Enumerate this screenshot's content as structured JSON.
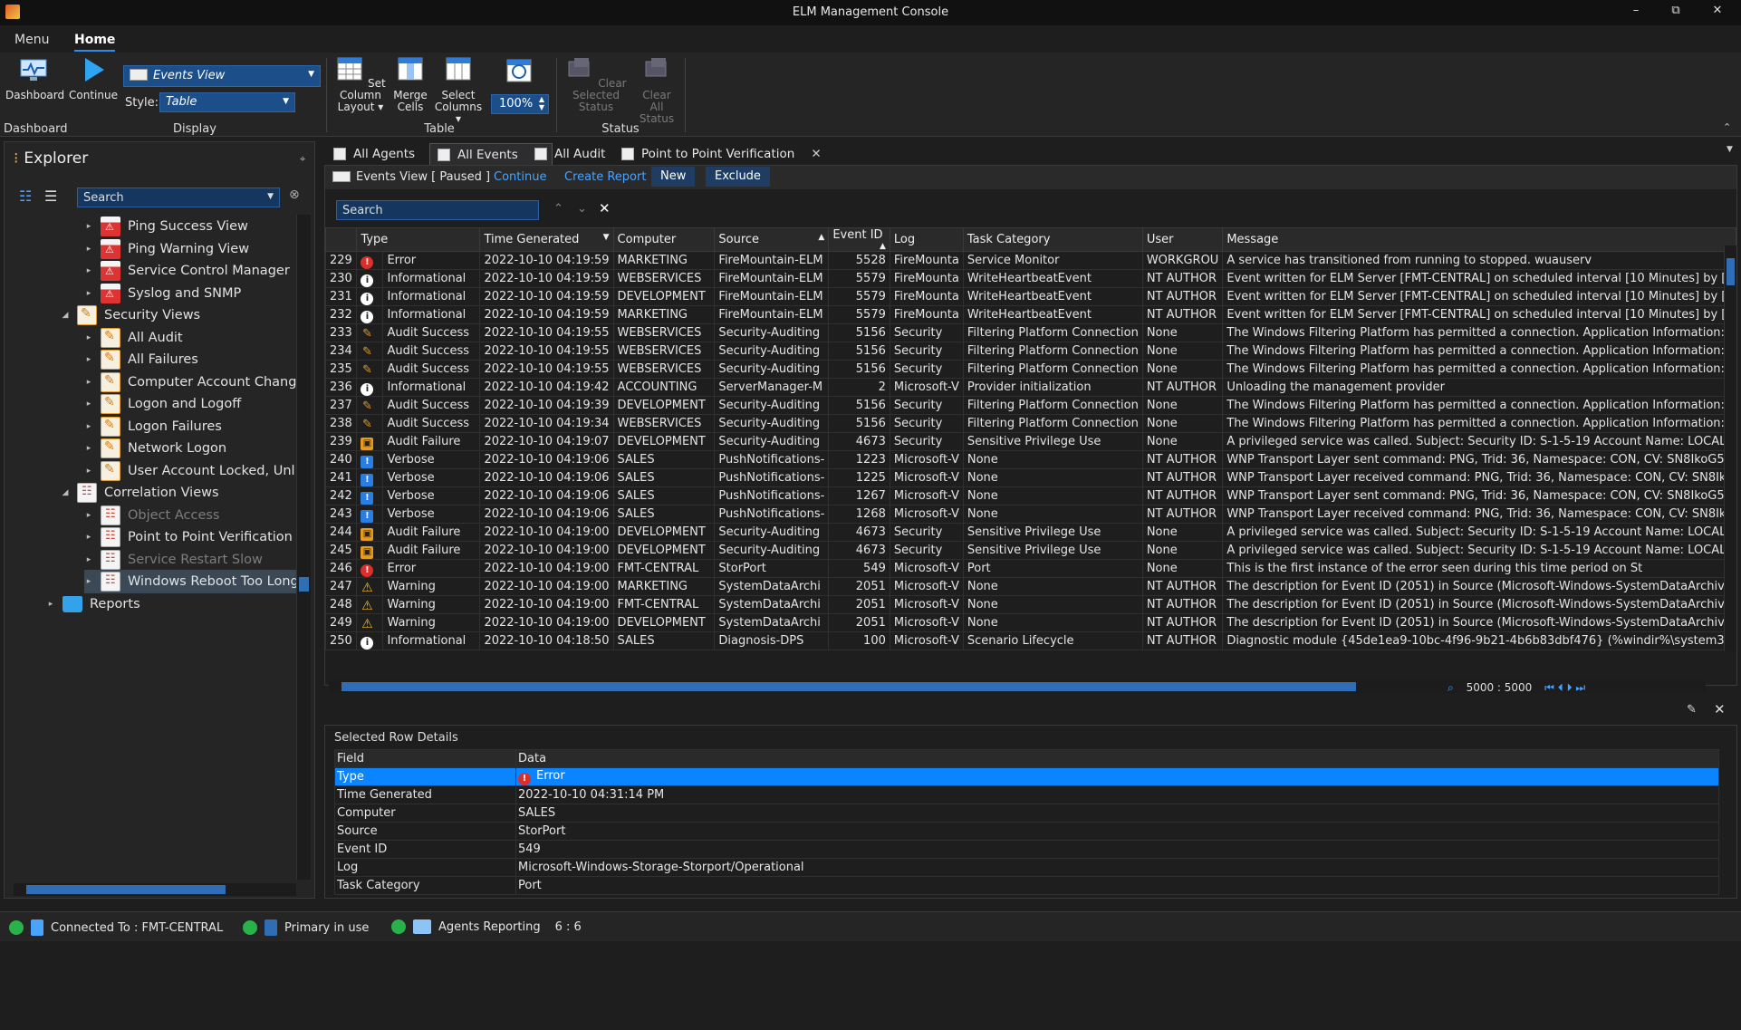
{
  "window": {
    "title": "ELM Management Console",
    "controls": [
      "–",
      "⧉",
      "✕"
    ]
  },
  "ribbon": {
    "tabs": [
      "Menu",
      "Home"
    ],
    "active_tab": "Home",
    "dashboard_label": "Dashboard",
    "continue_label": "Continue",
    "view_combo": "Events View",
    "style_label": "Style:",
    "style_combo": "Table",
    "set_column_layout": "Set Column Layout",
    "merge_cells": "Merge Cells",
    "select_columns": "Select Columns",
    "zoom": "100%",
    "clear_selected_status": "Clear Selected Status",
    "clear_all_status": "Clear All Status",
    "groups": {
      "dashboard": "Dashboard",
      "display": "Display",
      "table": "Table",
      "status": "Status"
    }
  },
  "explorer": {
    "title": "Explorer",
    "search_placeholder": "Search",
    "tree": [
      {
        "label": "Ping Success View",
        "level": 2,
        "icon": "red",
        "dim": false
      },
      {
        "label": "Ping Warning View",
        "level": 2,
        "icon": "red",
        "dim": false
      },
      {
        "label": "Service Control Manager",
        "level": 2,
        "icon": "red",
        "dim": false
      },
      {
        "label": "Syslog and SNMP",
        "level": 2,
        "icon": "red",
        "dim": false
      },
      {
        "label": "Security Views",
        "level": 1,
        "icon": "orange",
        "dim": false
      },
      {
        "label": "All Audit",
        "level": 2,
        "icon": "orange",
        "dim": false
      },
      {
        "label": "All Failures",
        "level": 2,
        "icon": "orange",
        "dim": false
      },
      {
        "label": "Computer Account Chang",
        "level": 2,
        "icon": "orange",
        "dim": false
      },
      {
        "label": "Logon and Logoff",
        "level": 2,
        "icon": "orange",
        "dim": false
      },
      {
        "label": "Logon Failures",
        "level": 2,
        "icon": "orange",
        "dim": false
      },
      {
        "label": "Network Logon",
        "level": 2,
        "icon": "orange",
        "dim": false
      },
      {
        "label": "User Account Locked, Unl",
        "level": 2,
        "icon": "orange",
        "dim": false
      },
      {
        "label": "Correlation Views",
        "level": 1,
        "icon": "gray",
        "dim": false
      },
      {
        "label": "Object Access",
        "level": 2,
        "icon": "gray",
        "dim": true
      },
      {
        "label": "Point to Point Verification",
        "level": 2,
        "icon": "gray",
        "dim": false
      },
      {
        "label": "Service Restart Slow",
        "level": 2,
        "icon": "gray",
        "dim": true
      },
      {
        "label": "Windows Reboot Too Long",
        "level": 2,
        "icon": "gray",
        "dim": false,
        "selected": true
      },
      {
        "label": "Reports",
        "level": 0,
        "icon": "folder",
        "dim": false
      }
    ]
  },
  "doc_tabs": [
    {
      "label": "All Agents",
      "active": false
    },
    {
      "label": "All  Events",
      "active": true
    },
    {
      "label": "All Audit",
      "active": false
    },
    {
      "label": "Point to Point Verification",
      "active": false
    }
  ],
  "events": {
    "view_title": "Events View [ Paused ]",
    "continue_link": "Continue",
    "create_report_link": "Create Report",
    "new_button": "New",
    "exclude_button": "Exclude",
    "search_placeholder": "Search",
    "columns": [
      "",
      "Type",
      "Time Generated",
      "Computer",
      "Source",
      "Event ID",
      "Log",
      "Task Category",
      "User",
      "Message"
    ],
    "rows": [
      [
        "229",
        "err",
        "Error",
        "2022-10-10 04:19:59",
        "MARKETING",
        "FireMountain-ELM",
        "5528",
        "FireMounta",
        "Service Monitor",
        "WORKGROU",
        "A service has transitioned from running to stopped. wuauserv"
      ],
      [
        "230",
        "inf",
        "Informational",
        "2022-10-10 04:19:59",
        "WEBSERVICES",
        "FireMountain-ELM",
        "5579",
        "FireMounta",
        "WriteHeartbeatEvent",
        "NT AUTHOR",
        "Event written for ELM Server [FMT-CENTRAL] on scheduled interval [10 Minutes] by ["
      ],
      [
        "231",
        "inf",
        "Informational",
        "2022-10-10 04:19:59",
        "DEVELOPMENT",
        "FireMountain-ELM",
        "5579",
        "FireMounta",
        "WriteHeartbeatEvent",
        "NT AUTHOR",
        "Event written for ELM Server [FMT-CENTRAL] on scheduled interval [10 Minutes] by ["
      ],
      [
        "232",
        "inf",
        "Informational",
        "2022-10-10 04:19:59",
        "MARKETING",
        "FireMountain-ELM",
        "5579",
        "FireMounta",
        "WriteHeartbeatEvent",
        "NT AUTHOR",
        "Event written for ELM Server [FMT-CENTRAL] on scheduled interval [10 Minutes] by ["
      ],
      [
        "233",
        "key",
        "Audit Success",
        "2022-10-10 04:19:55",
        "WEBSERVICES",
        "Security-Auditing",
        "5156",
        "Security",
        "Filtering Platform Connection",
        "None",
        "The Windows Filtering Platform has permitted a connection. Application Information:"
      ],
      [
        "234",
        "key",
        "Audit Success",
        "2022-10-10 04:19:55",
        "WEBSERVICES",
        "Security-Auditing",
        "5156",
        "Security",
        "Filtering Platform Connection",
        "None",
        "The Windows Filtering Platform has permitted a connection. Application Information:"
      ],
      [
        "235",
        "key",
        "Audit Success",
        "2022-10-10 04:19:55",
        "WEBSERVICES",
        "Security-Auditing",
        "5156",
        "Security",
        "Filtering Platform Connection",
        "None",
        "The Windows Filtering Platform has permitted a connection. Application Information:"
      ],
      [
        "236",
        "inf",
        "Informational",
        "2022-10-10 04:19:42",
        "ACCOUNTING",
        "ServerManager-M",
        "2",
        "Microsoft-V",
        "Provider initialization",
        "NT AUTHOR",
        "Unloading the management provider"
      ],
      [
        "237",
        "key",
        "Audit Success",
        "2022-10-10 04:19:39",
        "DEVELOPMENT",
        "Security-Auditing",
        "5156",
        "Security",
        "Filtering Platform Connection",
        "None",
        "The Windows Filtering Platform has permitted a connection. Application Information:"
      ],
      [
        "238",
        "key",
        "Audit Success",
        "2022-10-10 04:19:34",
        "WEBSERVICES",
        "Security-Auditing",
        "5156",
        "Security",
        "Filtering Platform Connection",
        "None",
        "The Windows Filtering Platform has permitted a connection. Application Information:"
      ],
      [
        "239",
        "lock",
        "Audit Failure",
        "2022-10-10 04:19:07",
        "DEVELOPMENT",
        "Security-Auditing",
        "4673",
        "Security",
        "Sensitive Privilege Use",
        "None",
        "A privileged service was called. Subject: Security ID: S-1-5-19 Account Name: LOCAL"
      ],
      [
        "240",
        "verb",
        "Verbose",
        "2022-10-10 04:19:06",
        "SALES",
        "PushNotifications-",
        "1223",
        "Microsoft-V",
        "None",
        "NT AUTHOR",
        "WNP Transport Layer sent command: PNG, Trid: 36, Namespace: CON, CV: SN8IkoG5"
      ],
      [
        "241",
        "verb",
        "Verbose",
        "2022-10-10 04:19:06",
        "SALES",
        "PushNotifications-",
        "1225",
        "Microsoft-V",
        "None",
        "NT AUTHOR",
        "WNP Transport Layer received command: PNG, Trid: 36, Namespace: CON, CV: SN8Ik"
      ],
      [
        "242",
        "verb",
        "Verbose",
        "2022-10-10 04:19:06",
        "SALES",
        "PushNotifications-",
        "1267",
        "Microsoft-V",
        "None",
        "NT AUTHOR",
        "WNP Transport Layer sent command: PNG, Trid: 36, Namespace: CON, CV: SN8IkoG5"
      ],
      [
        "243",
        "verb",
        "Verbose",
        "2022-10-10 04:19:06",
        "SALES",
        "PushNotifications-",
        "1268",
        "Microsoft-V",
        "None",
        "NT AUTHOR",
        "WNP Transport Layer received command: PNG, Trid: 36, Namespace: CON, CV: SN8Ik"
      ],
      [
        "244",
        "lock",
        "Audit Failure",
        "2022-10-10 04:19:00",
        "DEVELOPMENT",
        "Security-Auditing",
        "4673",
        "Security",
        "Sensitive Privilege Use",
        "None",
        "A privileged service was called. Subject: Security ID: S-1-5-19 Account Name: LOCAL"
      ],
      [
        "245",
        "lock",
        "Audit Failure",
        "2022-10-10 04:19:00",
        "DEVELOPMENT",
        "Security-Auditing",
        "4673",
        "Security",
        "Sensitive Privilege Use",
        "None",
        "A privileged service was called. Subject: Security ID: S-1-5-19 Account Name: LOCAL"
      ],
      [
        "246",
        "err",
        "Error",
        "2022-10-10 04:19:00",
        "FMT-CENTRAL",
        "StorPort",
        "549",
        "Microsoft-V",
        "Port",
        "None",
        "This is the first instance of the error seen during this time period                    on St"
      ],
      [
        "247",
        "warn",
        "Warning",
        "2022-10-10 04:19:00",
        "MARKETING",
        "SystemDataArchi",
        "2051",
        "Microsoft-V",
        "None",
        "NT AUTHOR",
        "The description for Event ID (2051) in Source (Microsoft-Windows-SystemDataArchive"
      ],
      [
        "248",
        "warn",
        "Warning",
        "2022-10-10 04:19:00",
        "FMT-CENTRAL",
        "SystemDataArchi",
        "2051",
        "Microsoft-V",
        "None",
        "NT AUTHOR",
        "The description for Event ID (2051) in Source (Microsoft-Windows-SystemDataArchive"
      ],
      [
        "249",
        "warn",
        "Warning",
        "2022-10-10 04:19:00",
        "DEVELOPMENT",
        "SystemDataArchi",
        "2051",
        "Microsoft-V",
        "None",
        "NT AUTHOR",
        "The description for Event ID (2051) in Source (Microsoft-Windows-SystemDataArchive"
      ],
      [
        "250",
        "inf",
        "Informational",
        "2022-10-10 04:18:50",
        "SALES",
        "Diagnosis-DPS",
        "100",
        "Microsoft-V",
        "Scenario Lifecycle",
        "NT AUTHOR",
        "Diagnostic module {45de1ea9-10bc-4f96-9b21-4b6b83dbf476} (%windir%\\system32"
      ]
    ],
    "pager": "5000 : 5000"
  },
  "details": {
    "title": "Selected Row Details",
    "columns": [
      "Field",
      "Data"
    ],
    "rows": [
      [
        "Type",
        "Error"
      ],
      [
        "Time Generated",
        "2022-10-10 04:31:14 PM"
      ],
      [
        "Computer",
        "SALES"
      ],
      [
        "Source",
        "StorPort"
      ],
      [
        "Event ID",
        "549"
      ],
      [
        "Log",
        "Microsoft-Windows-Storage-Storport/Operational"
      ],
      [
        "Task Category",
        "Port"
      ]
    ]
  },
  "status": {
    "connected": "Connected To : FMT-CENTRAL",
    "primary": "Primary in use",
    "agents": "Agents Reporting",
    "agents_count": "6 : 6"
  }
}
